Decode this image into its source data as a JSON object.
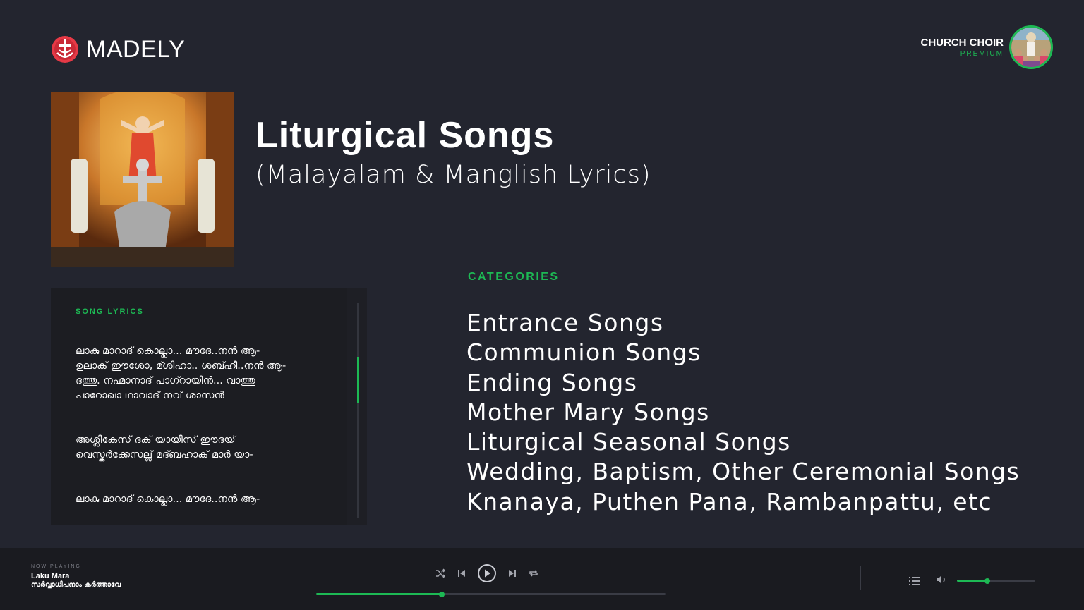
{
  "brand": {
    "name": "MADELY"
  },
  "account": {
    "name": "CHURCH CHOIR",
    "tier": "PREMIUM"
  },
  "album": {
    "title": "Liturgical Songs",
    "subtitle": "(Malayalam & Manglish Lyrics)"
  },
  "lyrics": {
    "heading": "SONG LYRICS",
    "stanzas": [
      "ലാകു മാറാദ് കൊല്ലാ... മൗദേ..നൻ ആ-\nഉലാക് ഈശോ, മ്ശിഹാ.. ശബ്ഹീ..നൻ ആ-\nദത്തു. നഹ്മാനാദ് പാഗ്റായിൻ... വാത്തു\nപാറോഖാ ഥാവാദ് നവ് ശാസൻ",
      "അശ്ലീകേസ് ദക് യായീസ് ഈദയ്\nവെസ്കർക്കേസല്ല് മദ്ബഹാക് മാർ യാ-",
      "ലാകു മാറാദ് കൊല്ലാ... മൗദേ..നൻ ആ-"
    ]
  },
  "categories": {
    "heading": "CATEGORIES",
    "items": [
      "Entrance Songs",
      "Communion Songs",
      "Ending Songs",
      "Mother Mary Songs",
      "Liturgical Seasonal Songs",
      "Wedding, Baptism, Other Ceremonial Songs",
      "Knanaya, Puthen Pana, Rambanpattu, etc"
    ]
  },
  "player": {
    "label": "NOW PLAYING",
    "title": "Laku Mara",
    "artist": "സർവ്വാധിപനാം കർത്താവേ",
    "progress": 0.36,
    "volume": 0.39,
    "icons": [
      "shuffle-icon",
      "previous-icon",
      "play-icon",
      "next-icon",
      "repeat-icon",
      "queue-icon",
      "volume-icon"
    ]
  },
  "colors": {
    "accent": "#1db954",
    "background": "#23252f",
    "panel": "#1c1d22",
    "playerbar": "#1a1b20"
  }
}
